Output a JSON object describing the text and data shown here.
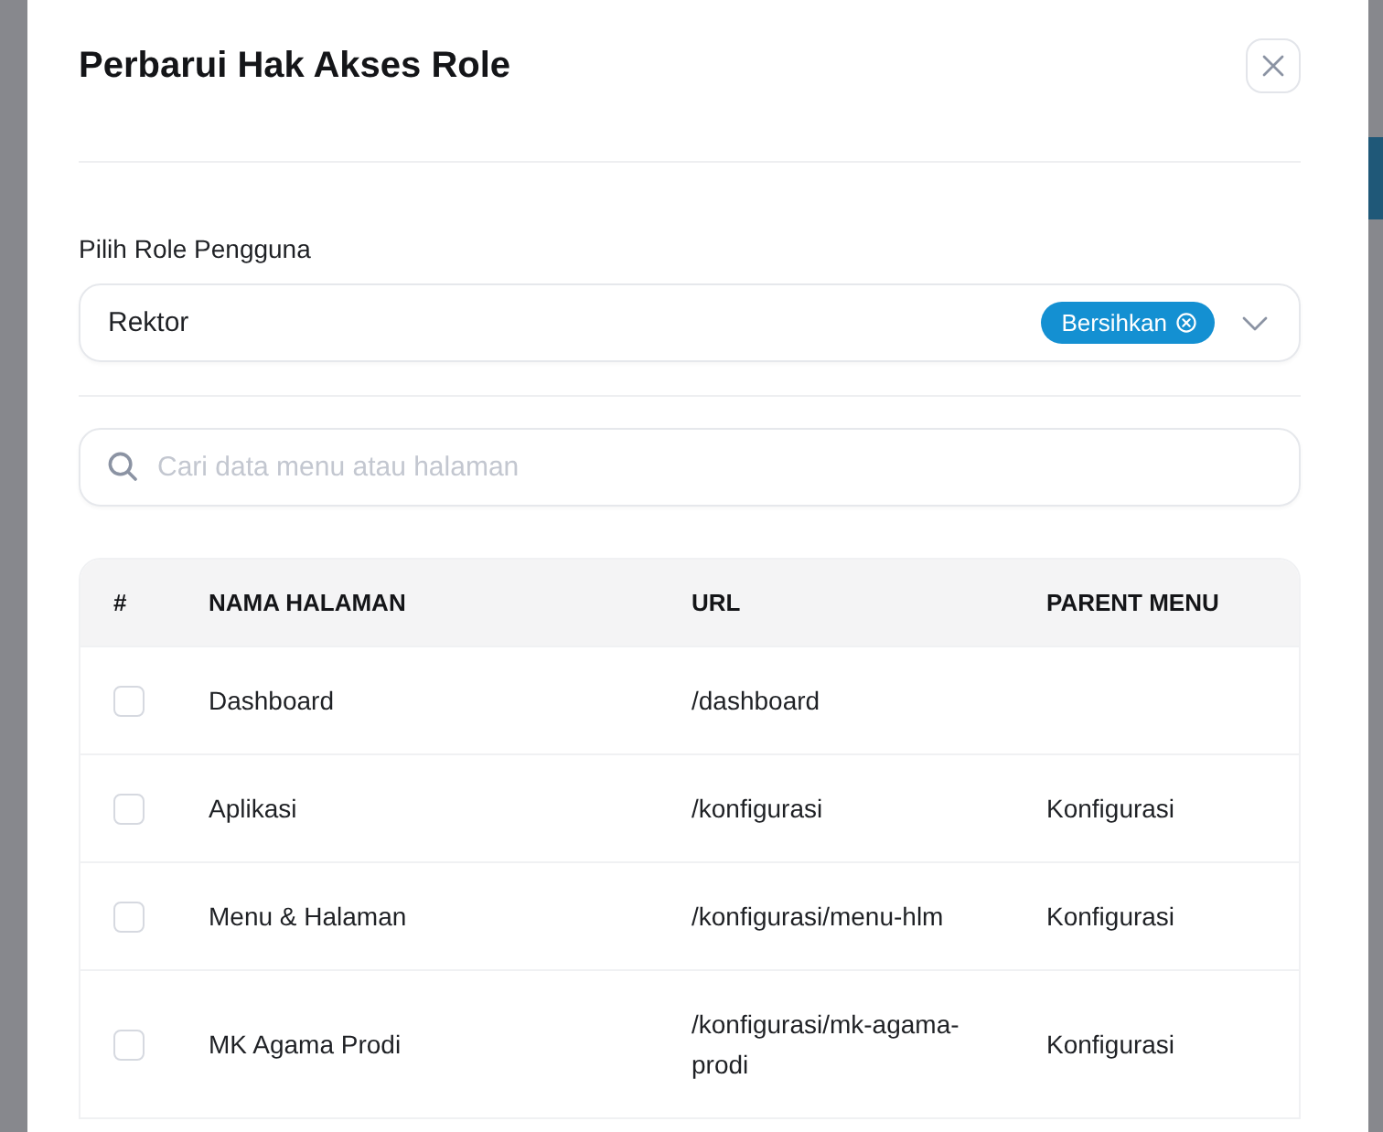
{
  "dialog": {
    "title": "Perbarui Hak Akses Role",
    "role_select": {
      "label": "Pilih Role Pengguna",
      "value": "Rektor",
      "clear_badge": "Bersihkan"
    },
    "search": {
      "placeholder": "Cari data menu atau halaman"
    },
    "table": {
      "columns": [
        "#",
        "NAMA HALAMAN",
        "URL",
        "PARENT MENU"
      ],
      "rows": [
        {
          "checked": false,
          "name": "Dashboard",
          "url": "/dashboard"
        },
        {
          "checked": false,
          "name": "Aplikasi",
          "url": "/konfigurasi",
          "parent_menu": "Konfigurasi"
        },
        {
          "checked": false,
          "name": "Menu & Halaman",
          "url": "/konfigurasi/menu-hlm",
          "parent_menu": "Konfigurasi"
        },
        {
          "checked": false,
          "name": "MK Agama Prodi",
          "url": "/konfigurasi/mk-agama-prodi",
          "parent_menu": "Konfigurasi"
        }
      ]
    }
  }
}
